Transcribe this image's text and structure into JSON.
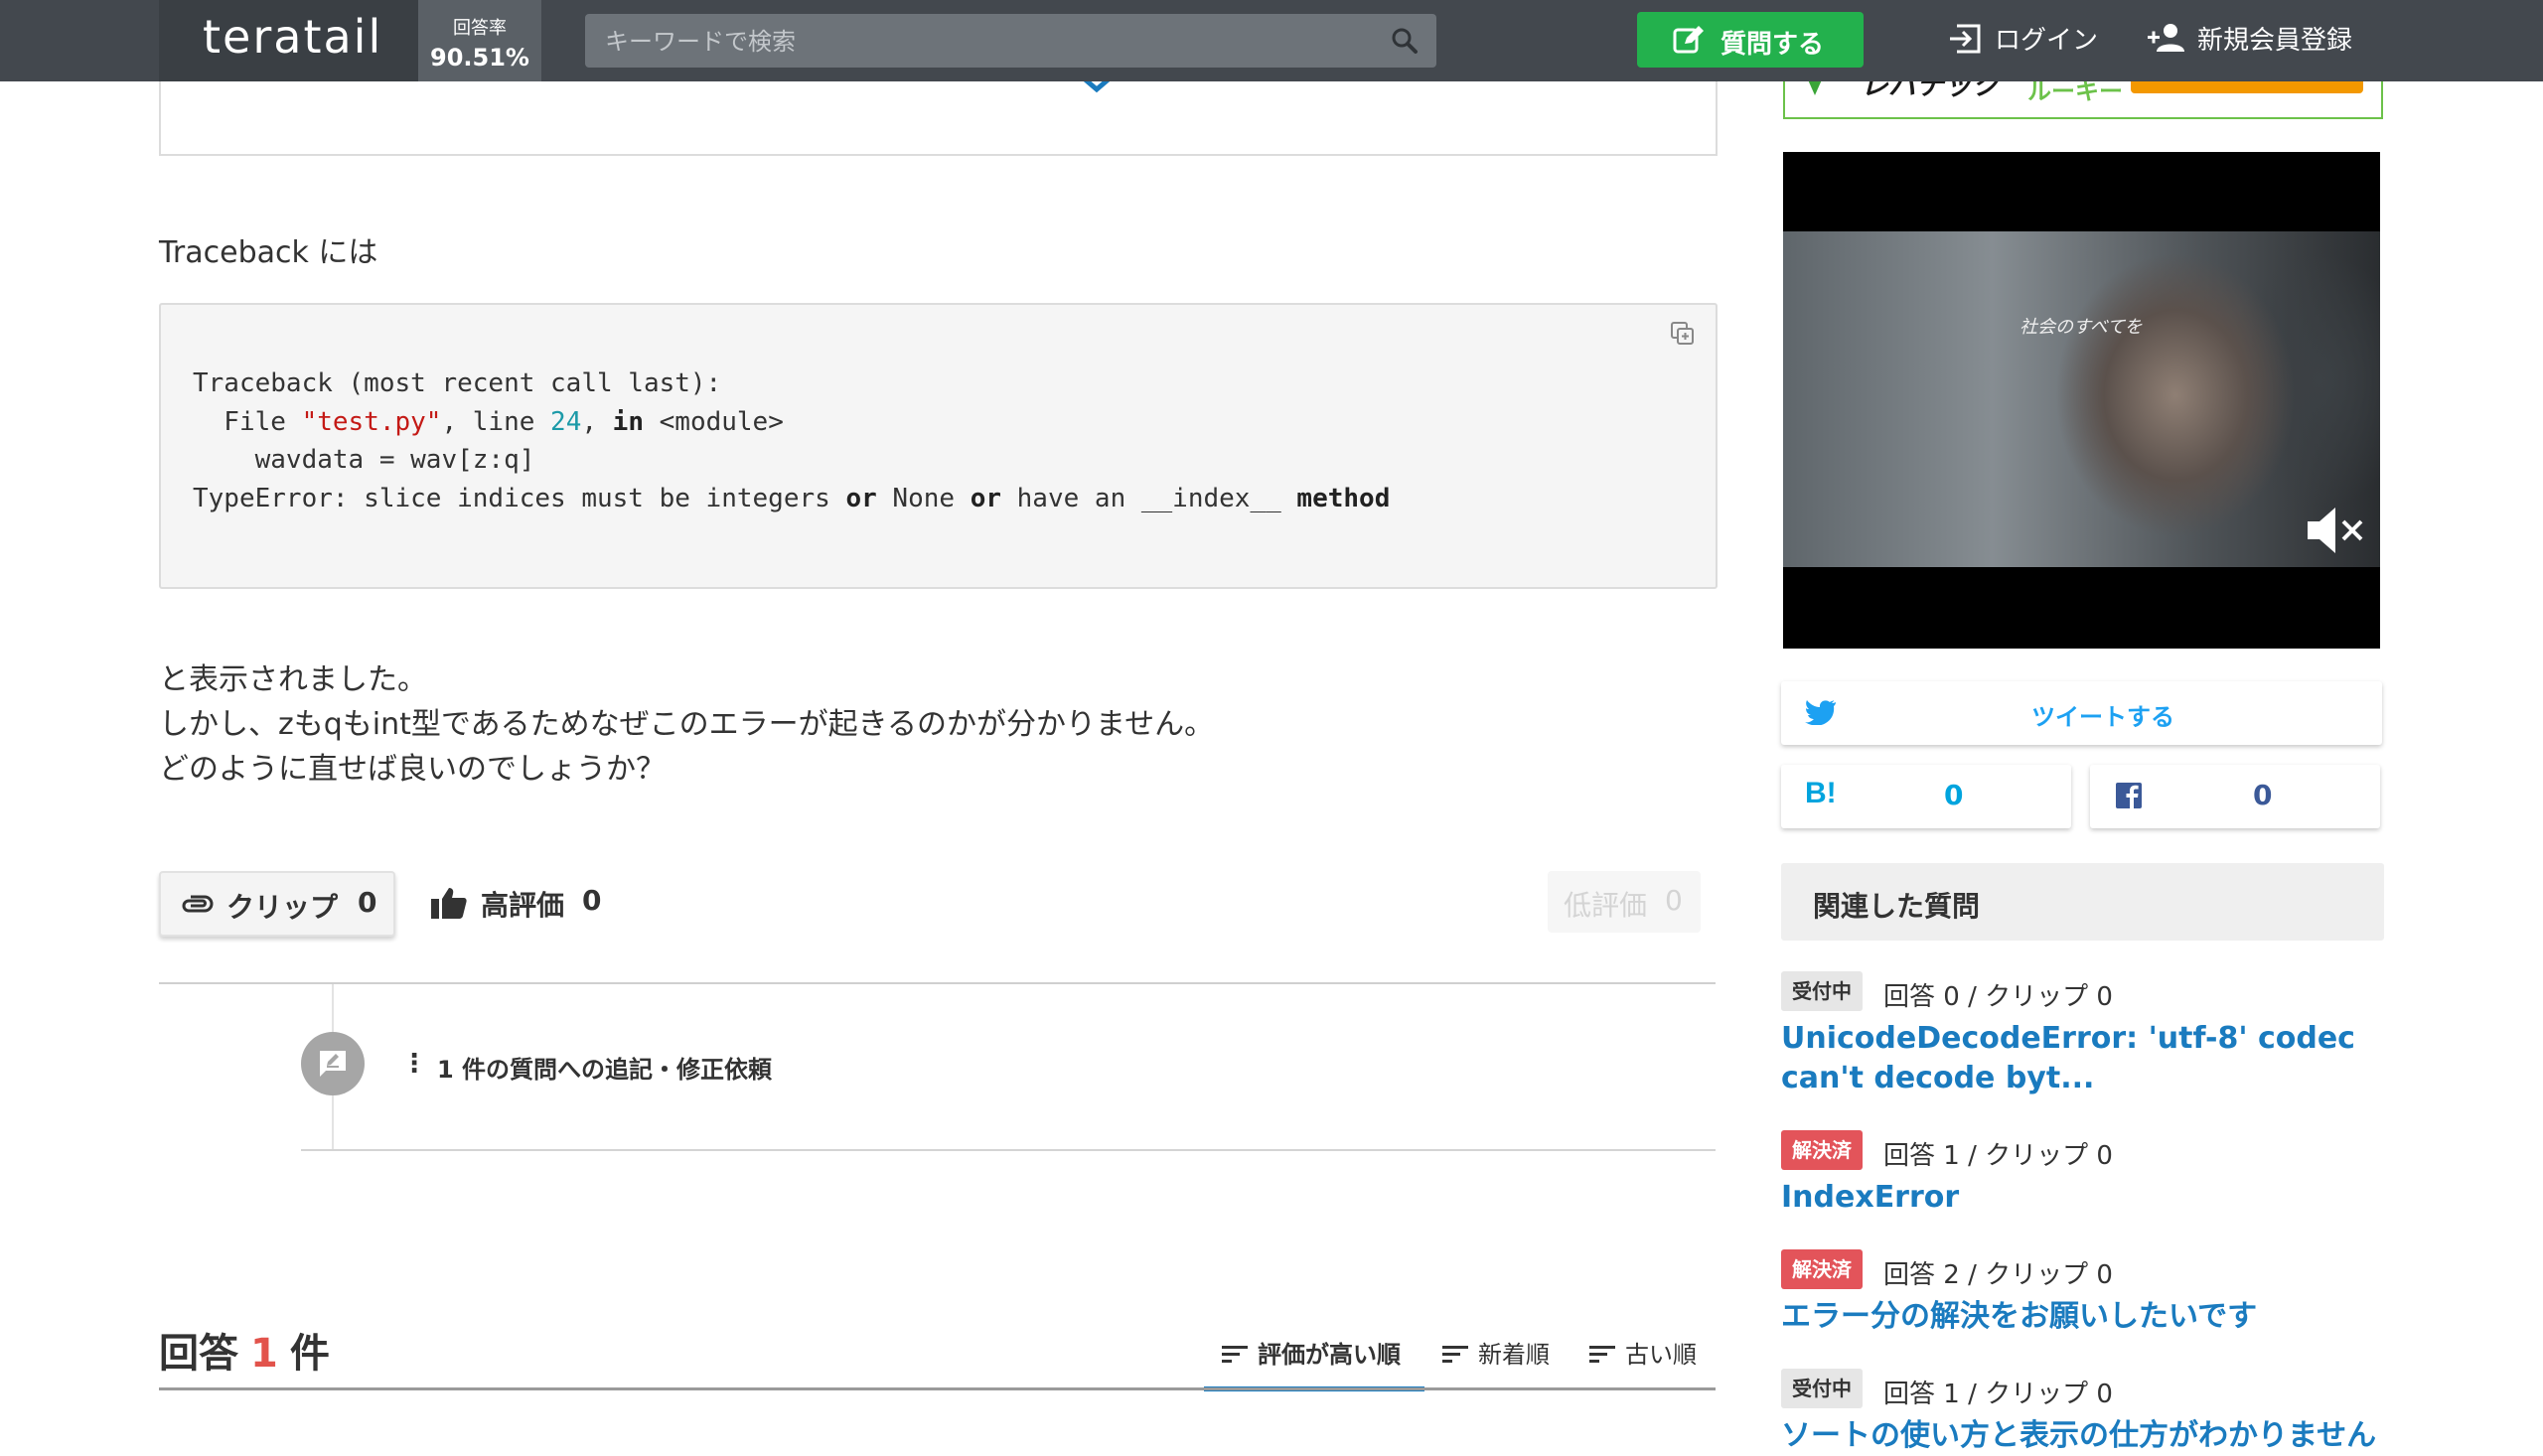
{
  "header": {
    "logo": "teratail",
    "answer_rate_label": "回答率",
    "answer_rate_value": "90.51%",
    "search_placeholder": "キーワードで検索",
    "ask_label": "質問する",
    "login_label": "ログイン",
    "signup_label": "新規会員登録"
  },
  "question": {
    "traceback_intro": "Traceback には",
    "code_lines": [
      "Traceback (most recent call last):",
      "  File ",
      "\"test.py\"",
      ", line ",
      "24",
      ", ",
      "in",
      " <module>",
      "    wavdata = wav[z:q]",
      "TypeError: slice indices must be integers ",
      "or",
      " None ",
      "or",
      " have an __index__ ",
      "method"
    ],
    "body_lines": [
      "と表示されました。",
      "しかし、zもqもint型であるためなぜこのエラーが起きるのかが分かりません。",
      "どのように直せば良いのでしょうか？"
    ],
    "clip_label": "クリップ",
    "clip_count": "0",
    "good_label": "高評価",
    "good_count": "0",
    "bad_label": "低評価",
    "bad_count": "0",
    "comment_dots": "⋮",
    "comment_text": "1 件の質問への追記・修正依頼"
  },
  "answers": {
    "title_prefix": "回答",
    "count": "1",
    "title_suffix": "件",
    "sort_tabs": [
      "評価が高い順",
      "新着順",
      "古い順"
    ],
    "active_sort": "評価が高い順"
  },
  "sidebar": {
    "ad_name": "レバテック",
    "ad_sub": "ルーキー",
    "video_caption": "社会のすべてを",
    "tweet_label": "ツイートする",
    "hatena_label": "B!",
    "hatena_count": "0",
    "facebook_count": "0",
    "related_title": "関連した質問",
    "related": [
      {
        "status": "受付中",
        "meta": "回答 0 / クリップ 0",
        "title": "UnicodeDecodeError: 'utf-8' codec can't decode byt..."
      },
      {
        "status": "解決済",
        "meta": "回答 1 / クリップ 0",
        "title": "IndexError"
      },
      {
        "status": "解決済",
        "meta": "回答 2 / クリップ 0",
        "title": "エラー分の解決をお願いしたいです"
      },
      {
        "status": "受付中",
        "meta": "回答 1 / クリップ 0",
        "title": "ソートの使い方と表示の仕方がわかりません"
      }
    ]
  },
  "colors": {
    "header_bg": "#43484e",
    "ask_button": "#23b14d",
    "link_blue": "#1a7bbf",
    "solved_badge": "#e3545a",
    "answer_count": "#e2534b"
  }
}
